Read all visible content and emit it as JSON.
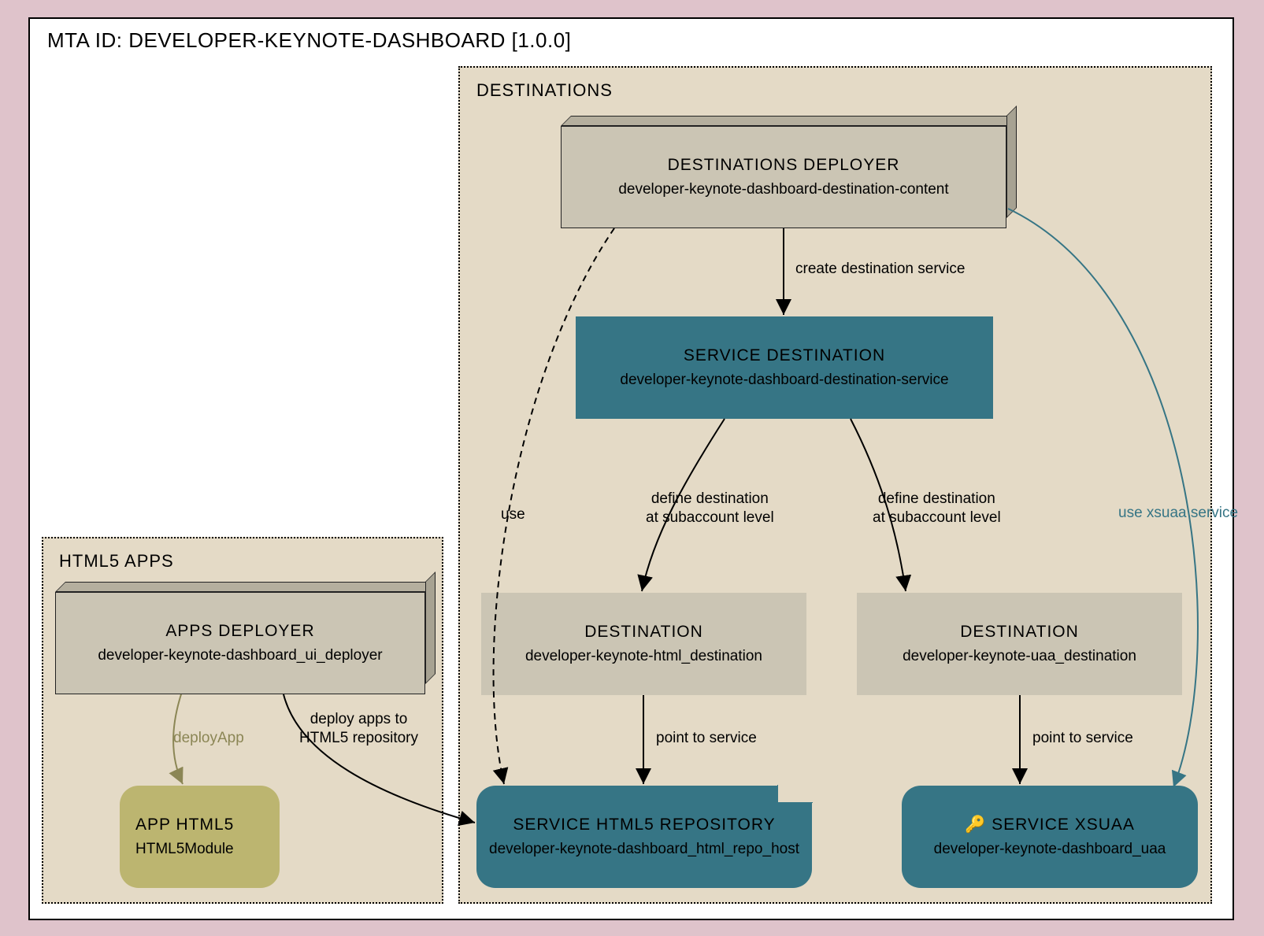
{
  "title": "MTA ID: DEVELOPER-KEYNOTE-DASHBOARD [1.0.0]",
  "groups": {
    "html5apps": {
      "title": "HTML5 APPS"
    },
    "destinations": {
      "title": "DESTINATIONS"
    }
  },
  "nodes": {
    "appsDeployer": {
      "title": "APPS DEPLOYER",
      "sub": "developer-keynote-dashboard_ui_deployer"
    },
    "appHtml5": {
      "title": "APP HTML5",
      "sub": "HTML5Module"
    },
    "destDeployer": {
      "title": "DESTINATIONS DEPLOYER",
      "sub": "developer-keynote-dashboard-destination-content"
    },
    "serviceDest": {
      "title": "SERVICE DESTINATION",
      "sub": "developer-keynote-dashboard-destination-service"
    },
    "destHtml": {
      "title": "DESTINATION",
      "sub": "developer-keynote-html_destination"
    },
    "destUaa": {
      "title": "DESTINATION",
      "sub": "developer-keynote-uaa_destination"
    },
    "svcRepo": {
      "title": "SERVICE HTML5 REPOSITORY",
      "sub": "developer-keynote-dashboard_html_repo_host"
    },
    "svcXsuaa": {
      "title": "SERVICE XSUAA",
      "sub": "developer-keynote-dashboard_uaa"
    }
  },
  "edges": {
    "deployApp": "deployApp",
    "deployRepo": "deploy apps to\nHTML5 repository",
    "use": "use",
    "createDestSvc": "create destination service",
    "defineSub1": "define destination\nat subaccount level",
    "defineSub2": "define destination\nat subaccount level",
    "pointSvc1": "point to service",
    "pointSvc2": "point to service",
    "useXsuaa": "use xsuaa service"
  },
  "icons": {
    "key": "key-icon"
  }
}
